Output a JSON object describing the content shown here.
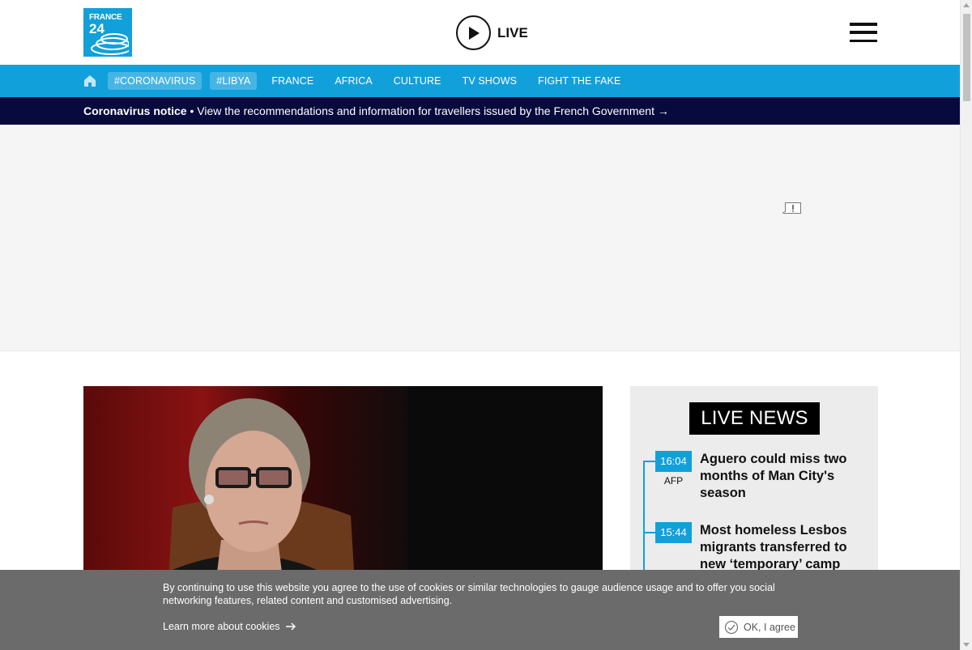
{
  "header": {
    "logo": {
      "line1": "FRANCE",
      "line2": "24",
      "icon": "france24-logo"
    },
    "live": {
      "label": "LIVE",
      "icon": "play-icon"
    },
    "menu": {
      "icon": "hamburger-menu-icon"
    }
  },
  "nav": {
    "home_icon": "home-icon",
    "items": [
      {
        "label": "#CORONAVIRUS",
        "tag": true
      },
      {
        "label": "#LIBYA",
        "tag": true
      },
      {
        "label": "FRANCE",
        "tag": false
      },
      {
        "label": "AFRICA",
        "tag": false
      },
      {
        "label": "CULTURE",
        "tag": false
      },
      {
        "label": "TV SHOWS",
        "tag": false
      },
      {
        "label": "FIGHT THE FAKE",
        "tag": false
      }
    ]
  },
  "notice": {
    "title": "Coronavirus notice",
    "text": " • View the recommendations and information for travellers issued by the French Government →"
  },
  "ad": {
    "icon": "ad-report-icon"
  },
  "hero": {
    "image": "photo-of-woman-in-glasses"
  },
  "live_news": {
    "title": "LIVE NEWS",
    "items": [
      {
        "time": "16:04",
        "source": "AFP",
        "headline": "Aguero could miss two months of Man City's season"
      },
      {
        "time": "15:44",
        "source": "",
        "headline": "Most homeless Lesbos migrants transferred to new ‘temporary’ camp"
      }
    ]
  },
  "cookie": {
    "text": "By continuing to use this website you agree to the use of cookies or similar technologies to gauge audience usage and to offer you social networking features, related content and customised advertising.",
    "learn_more": "Learn more about cookies",
    "ok": "OK, I agree"
  },
  "colors": {
    "brand_blue": "#12a0db",
    "notice_bg": "#060a3c",
    "cookie_bg": "#6b6b6b"
  }
}
